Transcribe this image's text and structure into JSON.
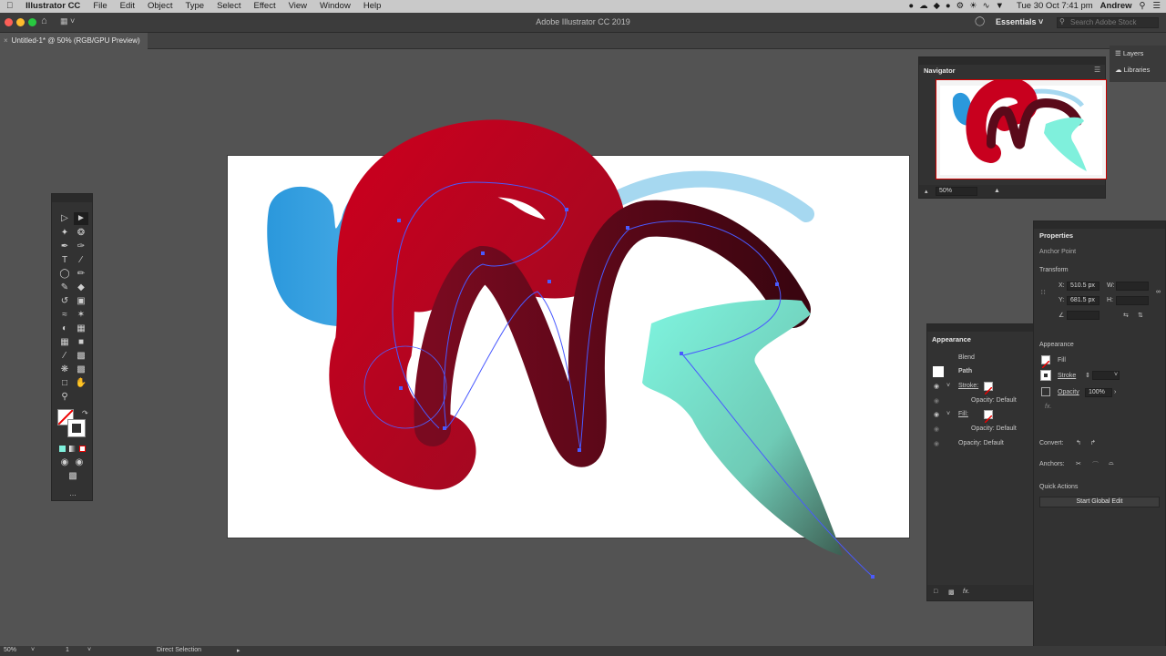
{
  "menubar": {
    "app_name": "Illustrator CC",
    "menus": [
      "File",
      "Edit",
      "Object",
      "Type",
      "Select",
      "Effect",
      "View",
      "Window",
      "Help"
    ],
    "clock": "Tue 30 Oct  7:41 pm",
    "user": "Andrew"
  },
  "appbar": {
    "title": "Adobe Illustrator CC 2019",
    "workspace": "Essentials",
    "search_placeholder": "Search Adobe Stock"
  },
  "document": {
    "tab_label": "Untitled-1* @ 50% (RGB/GPU Preview)"
  },
  "colors": {
    "accent_red": "#c8001e",
    "dark_red": "#5a0a1a",
    "blue": "#2f9ddc",
    "mint": "#7ff0dc",
    "path_blue": "#4a5aff"
  },
  "dock": {
    "layers": "Layers",
    "libraries": "Libraries"
  },
  "navigator": {
    "title": "Navigator",
    "zoom": "50%"
  },
  "appearance": {
    "title": "Appearance",
    "type_label": "Blend",
    "object_label": "Path",
    "stroke_label": "Stroke:",
    "stroke_opacity": "Opacity:  Default",
    "fill_label": "Fill:",
    "fill_opacity": "Opacity:  Default",
    "opacity": "Opacity:  Default"
  },
  "properties": {
    "title": "Properties",
    "context": "Anchor Point",
    "transform_label": "Transform",
    "x_label": "X:",
    "x_value": "510.5 px",
    "y_label": "Y:",
    "y_value": "681.5 px",
    "w_label": "W:",
    "h_label": "H:",
    "appearance_label": "Appearance",
    "fill_label": "Fill",
    "stroke_label": "Stroke",
    "opacity_label": "Opacity",
    "opacity_value": "100%",
    "fx_label": "fx.",
    "convert_label": "Convert:",
    "anchors_label": "Anchors:",
    "quick_actions_label": "Quick Actions",
    "global_edit_button": "Start Global Edit"
  },
  "statusbar": {
    "zoom": "50%",
    "artboard": "1",
    "tool": "Direct Selection"
  }
}
